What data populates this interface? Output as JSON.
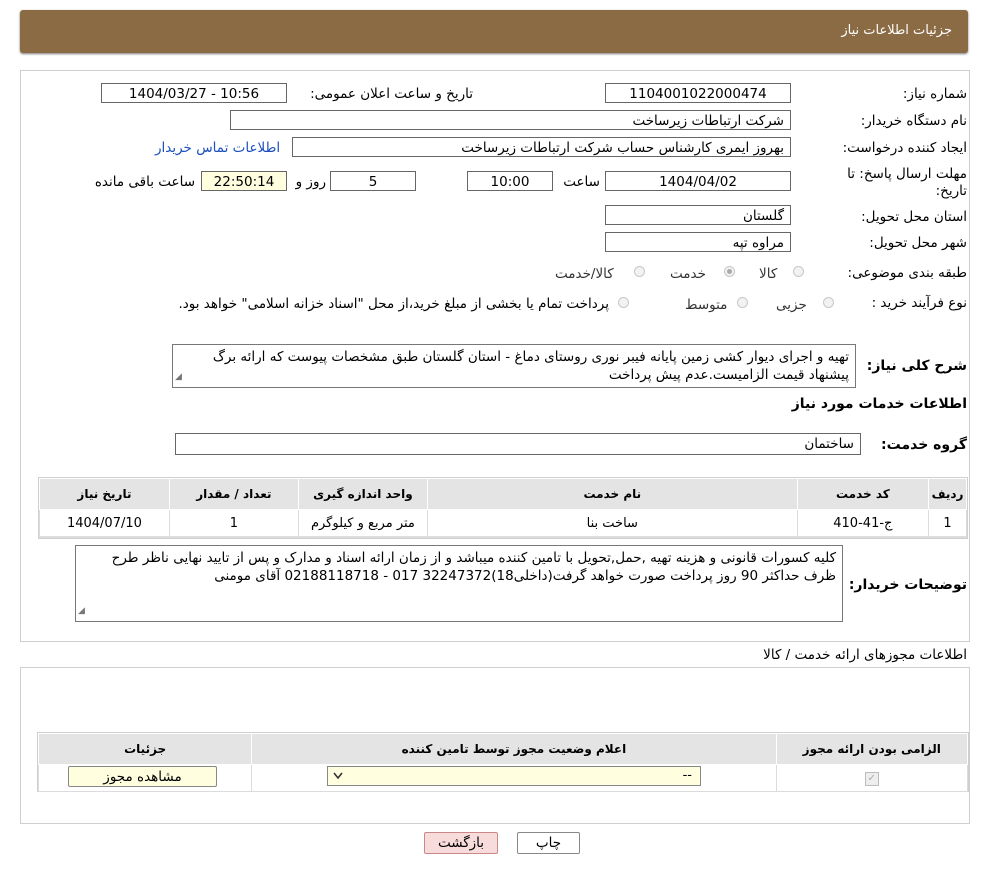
{
  "header": {
    "title": "جزئیات اطلاعات نیاز"
  },
  "fields": {
    "need_number_label": "شماره نیاز:",
    "need_number": "1104001022000474",
    "announce_label": "تاریخ و ساعت اعلان عمومی:",
    "announce_value": "1404/03/27 - 10:56",
    "buyer_org_label": "نام دستگاه خریدار:",
    "buyer_org": "شرکت ارتباطات زیرساخت",
    "creator_label": "ایجاد کننده درخواست:",
    "creator": "بهروز ایمری کارشناس حساب شرکت ارتباطات زیرساخت",
    "contact_link": "اطلاعات تماس خریدار",
    "deadline_label_1": "مهلت ارسال پاسخ: تا",
    "deadline_label_2": "تاریخ:",
    "deadline_date": "1404/04/02",
    "time_label": "ساعت",
    "deadline_time": "10:00",
    "days_value": "5",
    "days_label": "روز و",
    "remaining_time": "22:50:14",
    "remaining_label": "ساعت باقی مانده",
    "province_label": "استان محل تحویل:",
    "province": "گلستان",
    "city_label": "شهر محل تحویل:",
    "city": "مراوه تپه",
    "category_label": "طبقه بندی موضوعی:",
    "category_options": [
      "کالا",
      "خدمت",
      "کالا/خدمت"
    ],
    "process_label": "نوع فرآیند خرید :",
    "process_options": [
      "جزیی",
      "متوسط"
    ],
    "process_note": "پرداخت تمام یا بخشی از مبلغ خرید،از محل \"اسناد خزانه اسلامی\" خواهد بود."
  },
  "description": {
    "label": "شرح کلی نیاز:",
    "text": "تهیه و اجرای دیوار کشی زمین پایانه فیبر نوری روستای دماغ - استان گلستان   طبق مشخصات پیوست که ارائه برگ پیشنهاد قیمت الزامیست.عدم پیش پرداخت"
  },
  "services": {
    "section_title": "اطلاعات خدمات مورد نیاز",
    "group_label": "گروه خدمت:",
    "group_value": "ساختمان",
    "columns": [
      "ردیف",
      "کد خدمت",
      "نام خدمت",
      "واحد اندازه گیری",
      "تعداد / مقدار",
      "تاریخ نیاز"
    ],
    "rows": [
      {
        "row": "1",
        "code": "ج-41-410",
        "name": "ساخت بنا",
        "unit": "متر مربع و کیلوگرم",
        "qty": "1",
        "date": "1404/07/10"
      }
    ]
  },
  "buyer_notes": {
    "label": "توضیحات خریدار:",
    "text": "کلیه کسورات قانونی و هزینه تهیه ,حمل,تحویل با تامین کننده میباشد و از زمان ارائه اسناد و مدارک و پس از تایید نهایی ناظر طرح ظرف حداکثر 90 روز پرداخت صورت خواهد گرفت(داخلی18)32247372 017  -  02188118718 آقای مومنی"
  },
  "permits": {
    "section_title": "اطلاعات مجوزهای ارائه خدمت / کالا",
    "columns": [
      "الزامی بودن ارائه مجوز",
      "اعلام وضعیت مجوز توسط تامین کننده",
      "جزئیات"
    ],
    "select_value": "--",
    "view_button": "مشاهده مجوز"
  },
  "buttons": {
    "print": "چاپ",
    "back": "بازگشت"
  },
  "colors": {
    "header_bg": "#8b6b43",
    "link": "#1a4fbf",
    "back_button_bg": "#f8dcdc"
  }
}
